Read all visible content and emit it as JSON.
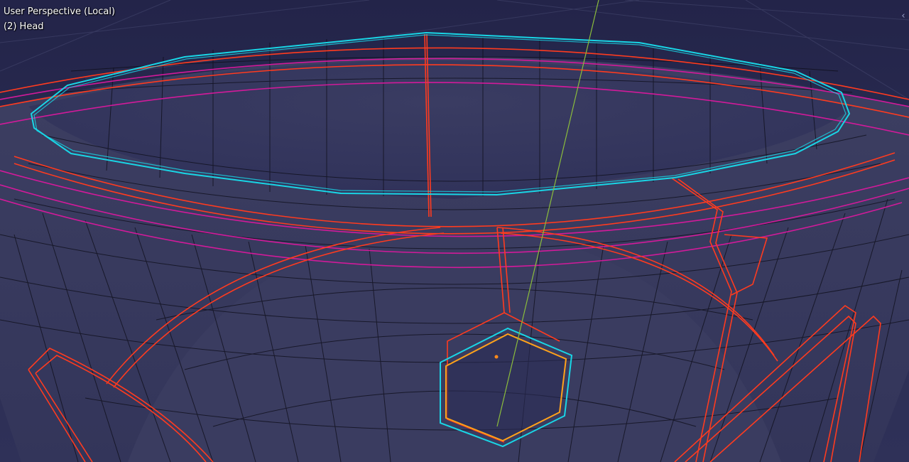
{
  "viewport": {
    "view_name": "User Perspective (Local)",
    "object_info": "(2) Head",
    "sidebar_toggle_glyph": "‹"
  },
  "colors": {
    "background": "#232449",
    "mesh_face": "#3a3c5e",
    "wire_edge": "#0d0d18",
    "seam_edge": "#ff3b1f",
    "sharp_edge": "#d21a9a",
    "selected_edge_active": "#19d6e6",
    "selected_face_outline": "#ffa21a",
    "grid_line": "#5a5d86",
    "axis_y": "#8bbd3c",
    "origin_point": "#ff8a1a"
  }
}
